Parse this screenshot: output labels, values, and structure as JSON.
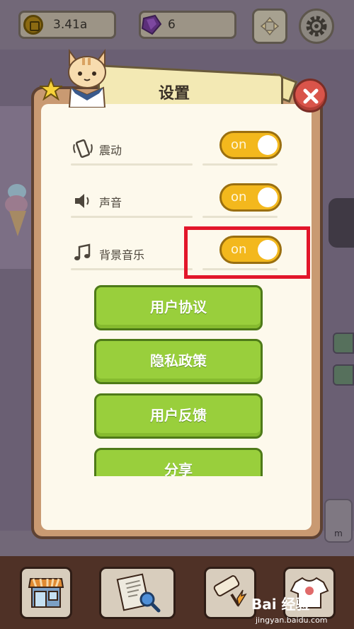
{
  "top_bar": {
    "coins": "3.41a",
    "gems": "6"
  },
  "dialog": {
    "title": "设置",
    "settings": [
      {
        "label": "震动",
        "icon": "vibrate-icon",
        "toggle": "on"
      },
      {
        "label": "声音",
        "icon": "speaker-icon",
        "toggle": "on"
      },
      {
        "label": "背景音乐",
        "icon": "music-note-icon",
        "toggle": "on"
      }
    ],
    "menu_buttons": [
      {
        "label": "用户协议"
      },
      {
        "label": "隐私政策"
      },
      {
        "label": "用户反馈"
      },
      {
        "label": "分享"
      }
    ]
  },
  "background": {
    "side_card_text": "m"
  },
  "watermark": {
    "logo": "Bai 经验",
    "url": "jingyan.baidu.com"
  },
  "colors": {
    "toggle_on": "#f3b81d",
    "menu_button": "#99cf3c",
    "close_button": "#d9544a",
    "highlight": "#e2162a",
    "dialog_bg": "#fdf9ec"
  }
}
